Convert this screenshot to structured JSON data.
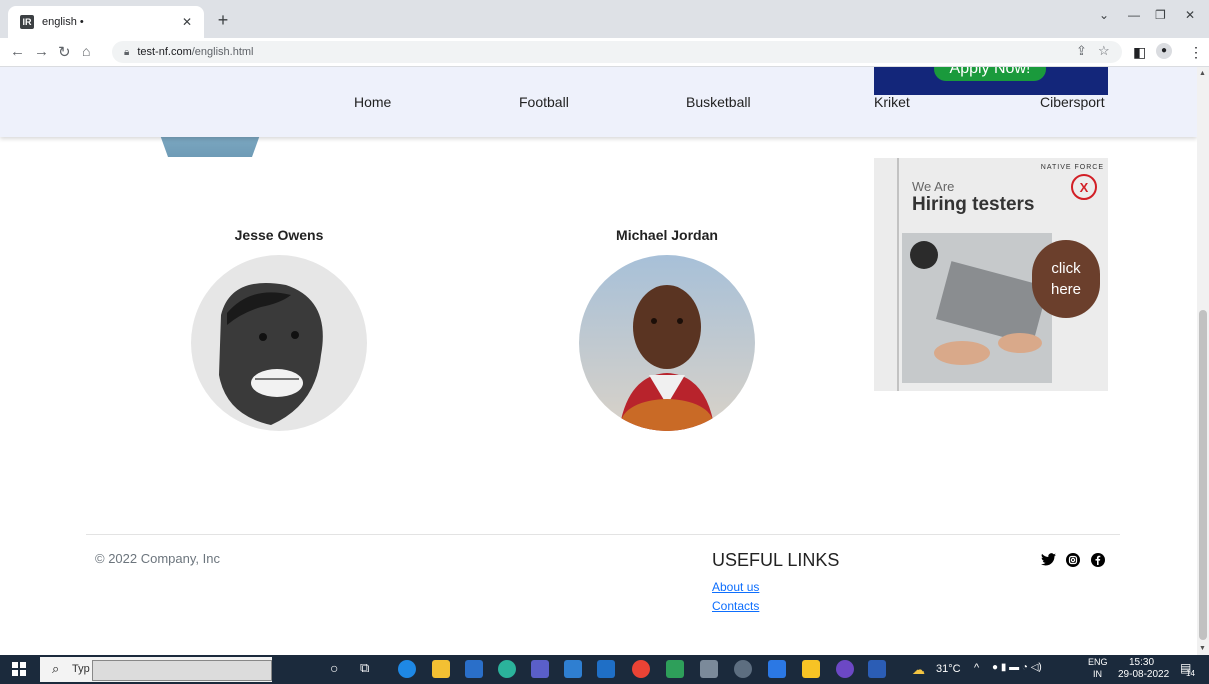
{
  "browser": {
    "tab_title": "english •",
    "url_host": "test-nf.com",
    "url_path": "/english.html"
  },
  "nav": {
    "items": [
      "Home",
      "Football",
      "Busketball",
      "Kriket",
      "Cibersport"
    ]
  },
  "ads": {
    "apply_label": "Apply Now!",
    "hire_brand": "NATIVE FORCE",
    "hire_close": "X",
    "hire_line1": "We Are",
    "hire_line2": "Hiring testers",
    "hire_click1": "click",
    "hire_click2": "here"
  },
  "people": [
    {
      "name": "Jesse Owens"
    },
    {
      "name": "Michael Jordan"
    }
  ],
  "footer": {
    "copyright": "© 2022 Company, Inc",
    "useful_title": "USEFUL LINKS",
    "links": [
      "About us",
      "Contacts"
    ]
  },
  "taskbar": {
    "search_text": "Typ",
    "weather": "31°C",
    "lang1": "ENG",
    "lang2": "IN",
    "time": "15:30",
    "date": "29-08-2022",
    "notif_count": "14"
  },
  "colors": {
    "nav_bg": "#eef1fb",
    "link": "#0d6efd",
    "apply_bg": "#1a9a3c",
    "banner_bg": "#13267a"
  }
}
